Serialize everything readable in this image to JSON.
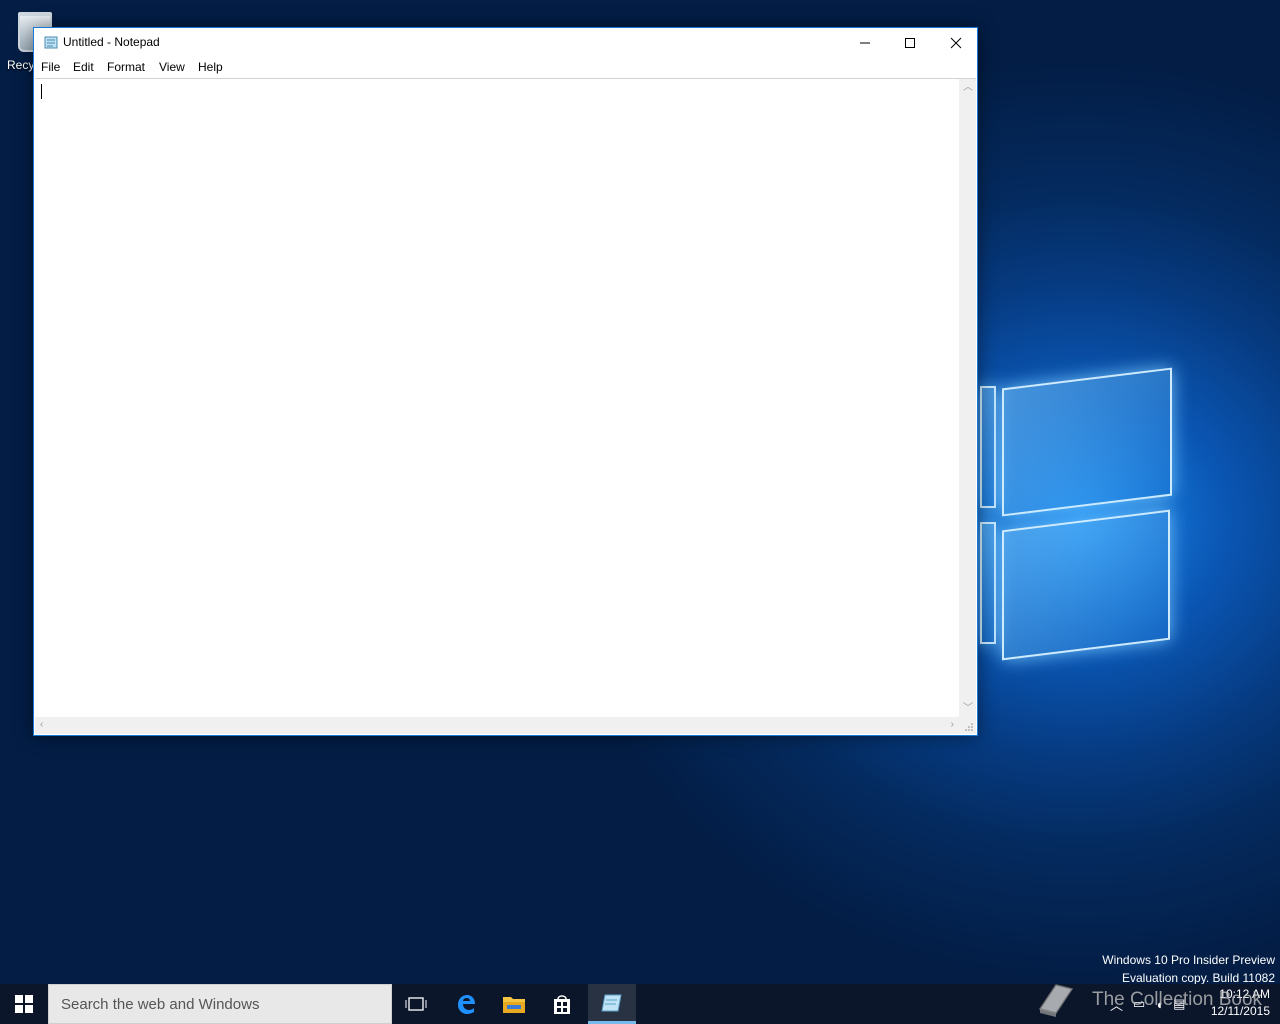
{
  "desktop": {
    "recycle_bin_label": "Recy",
    "watermark_line1": "Windows 10 Pro Insider Preview",
    "watermark_line2": "Evaluation copy. Build 11082"
  },
  "notepad": {
    "title": "Untitled - Notepad",
    "menu": [
      "File",
      "Edit",
      "Format",
      "View",
      "Help"
    ],
    "content": ""
  },
  "taskbar": {
    "search_placeholder": "Search the web and Windows",
    "clock_time": "10:12 AM",
    "clock_date": "12/11/2015",
    "brand_overlay": "The Collection Book"
  },
  "colors": {
    "window_border": "#1779d8",
    "taskbar_active": "#76b9ed"
  }
}
